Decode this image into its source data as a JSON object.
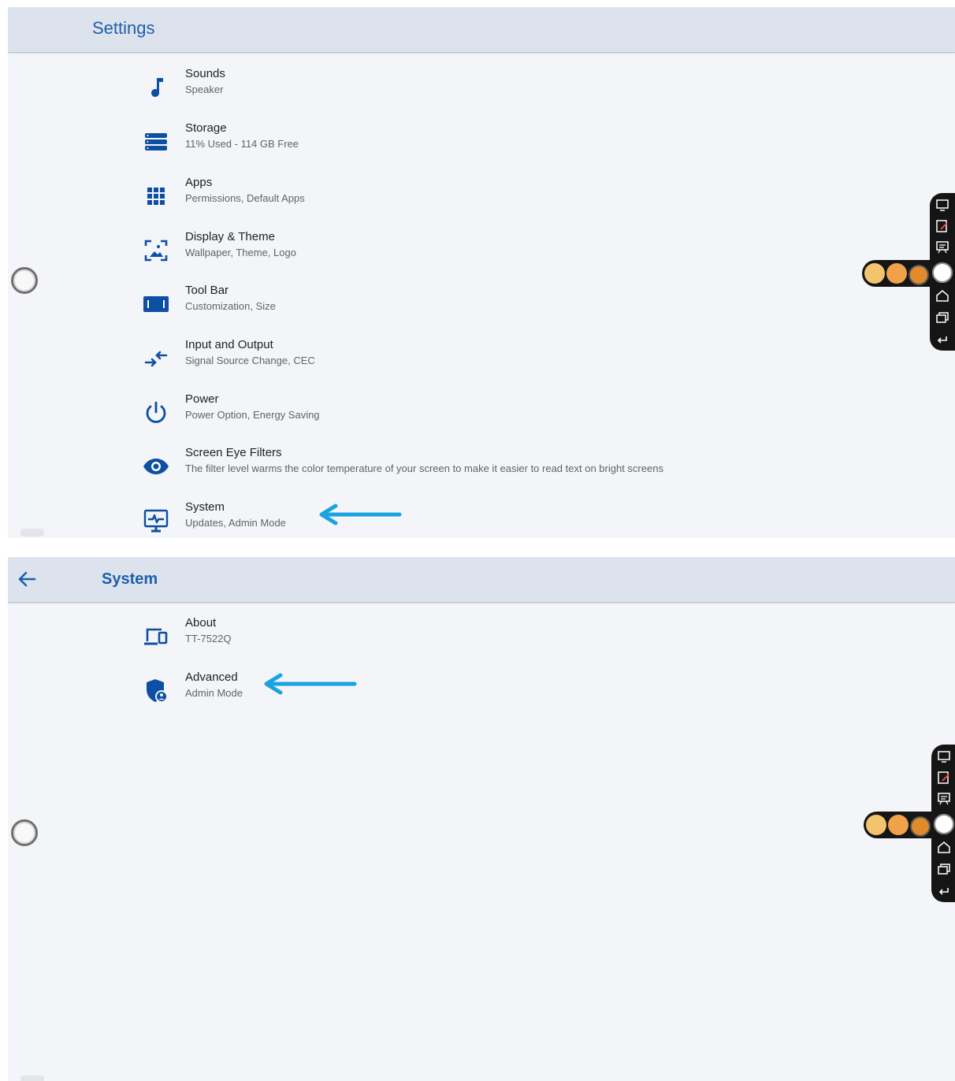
{
  "panel1": {
    "header": {
      "title": "Settings"
    },
    "items": [
      {
        "title": "Sounds",
        "subtitle": "Speaker",
        "icon": "music-note-icon"
      },
      {
        "title": "Storage",
        "subtitle": "11% Used - 114 GB Free",
        "icon": "storage-icon"
      },
      {
        "title": "Apps",
        "subtitle": "Permissions, Default Apps",
        "icon": "apps-grid-icon"
      },
      {
        "title": "Display & Theme",
        "subtitle": "Wallpaper, Theme, Logo",
        "icon": "display-wallpaper-icon"
      },
      {
        "title": "Tool Bar",
        "subtitle": "Customization, Size",
        "icon": "toolbar-icon"
      },
      {
        "title": "Input and Output",
        "subtitle": "Signal Source Change, CEC",
        "icon": "input-output-icon"
      },
      {
        "title": "Power",
        "subtitle": "Power Option, Energy Saving",
        "icon": "power-icon"
      },
      {
        "title": "Screen Eye Filters",
        "subtitle": "The filter level warms the color temperature of your screen to make it easier to read text on bright screens",
        "icon": "eye-icon"
      },
      {
        "title": "System",
        "subtitle": "Updates, Admin Mode",
        "icon": "system-monitor-icon"
      }
    ]
  },
  "panel2": {
    "header": {
      "title": "System"
    },
    "items": [
      {
        "title": "About",
        "subtitle": "TT-7522Q",
        "icon": "devices-icon"
      },
      {
        "title": "Advanced",
        "subtitle": "Admin Mode",
        "icon": "admin-shield-icon"
      }
    ]
  },
  "floating_toolbar": {
    "icons": [
      "ops-icon",
      "annotate-icon",
      "whiteboard-icon",
      "home-icon",
      "windows-icon",
      "back-icon"
    ],
    "quick_dots": [
      "#f2c46d",
      "#f0a14a",
      "#e08a2c"
    ]
  },
  "colors": {
    "accent": "#1d5fae",
    "icon_blue": "#0d4fa3",
    "header_bg": "#dde3ed",
    "panel_bg": "#f3f5f9",
    "arrow": "#1aa3e0"
  }
}
